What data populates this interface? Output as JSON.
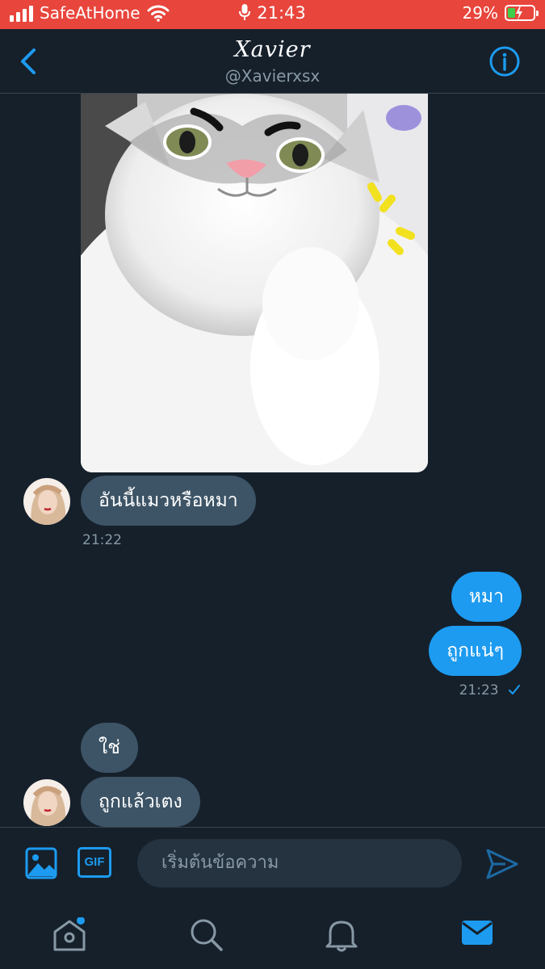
{
  "status_bar": {
    "carrier": "SafeAtHome",
    "time": "21:43",
    "battery": "29%",
    "battery_level": 0.29,
    "status_color": "#e8453c"
  },
  "header": {
    "name": "Xavier",
    "handle": "@Xavierxsx"
  },
  "messages": [
    {
      "direction": "incoming",
      "type": "image",
      "alt_icon": "cat-photo"
    },
    {
      "direction": "incoming",
      "text": "อันนี้แมวหรือหมา",
      "time": "21:22"
    },
    {
      "direction": "outgoing",
      "text": "หมา"
    },
    {
      "direction": "outgoing",
      "text": "ถูกแน่ๆ",
      "time": "21:23",
      "status_icon": "check-icon"
    },
    {
      "direction": "incoming",
      "text": "ใช่"
    },
    {
      "direction": "incoming",
      "text": "ถูกแล้วเตง"
    }
  ],
  "composer": {
    "placeholder": "เริ่มต้นข้อความ",
    "gif_label": "GIF"
  },
  "tabbar": {
    "items": [
      "home-icon",
      "search-icon",
      "notifications-icon",
      "messages-icon"
    ],
    "active": "messages-icon"
  },
  "colors": {
    "background": "#15202b",
    "accent": "#1d9bf0",
    "incoming_bubble": "#3d5466",
    "muted": "#8899a6"
  }
}
